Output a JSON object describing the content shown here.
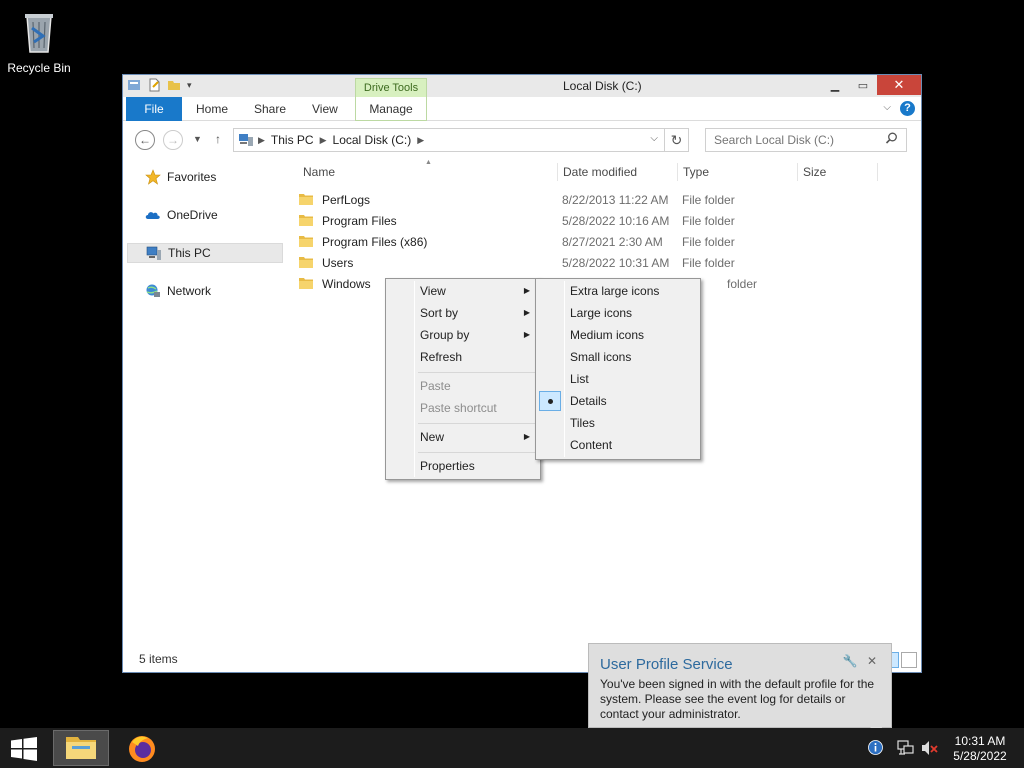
{
  "desktop": {
    "recycle_bin_label": "Recycle Bin"
  },
  "window": {
    "title": "Local Disk (C:)",
    "context_tab_group": "Drive Tools",
    "ribbon_tabs": {
      "file": "File",
      "home": "Home",
      "share": "Share",
      "view": "View",
      "manage": "Manage"
    },
    "address": {
      "crumbs": [
        "This PC",
        "Local Disk (C:)"
      ]
    },
    "search_placeholder": "Search Local Disk (C:)",
    "nav_pane": {
      "favorites": "Favorites",
      "onedrive": "OneDrive",
      "this_pc": "This PC",
      "network": "Network"
    },
    "columns": {
      "name": "Name",
      "date": "Date modified",
      "type": "Type",
      "size": "Size"
    },
    "files": [
      {
        "name": "PerfLogs",
        "date": "8/22/2013 11:22 AM",
        "type": "File folder"
      },
      {
        "name": "Program Files",
        "date": "5/28/2022 10:16 AM",
        "type": "File folder"
      },
      {
        "name": "Program Files (x86)",
        "date": "8/27/2021 2:30 AM",
        "type": "File folder"
      },
      {
        "name": "Users",
        "date": "5/28/2022 10:31 AM",
        "type": "File folder"
      },
      {
        "name": "Windows",
        "date": "",
        "type": "folder"
      }
    ],
    "status": "5 items"
  },
  "context_menu": {
    "view": "View",
    "sort_by": "Sort by",
    "group_by": "Group by",
    "refresh": "Refresh",
    "paste": "Paste",
    "paste_shortcut": "Paste shortcut",
    "new": "New",
    "properties": "Properties"
  },
  "view_submenu": {
    "items": [
      "Extra large icons",
      "Large icons",
      "Medium icons",
      "Small icons",
      "List",
      "Details",
      "Tiles",
      "Content"
    ],
    "selected": "Details"
  },
  "notification": {
    "title": "User Profile Service",
    "message": "You've been signed in with the default profile for the system. Please see the event log for details or contact your administrator."
  },
  "taskbar": {
    "time": "10:31 AM",
    "date": "5/28/2022"
  },
  "colors": {
    "accent": "#1979ca",
    "close": "#c9453a",
    "drive_tools": "#d8f0c0",
    "selected": "#cce8ff"
  }
}
